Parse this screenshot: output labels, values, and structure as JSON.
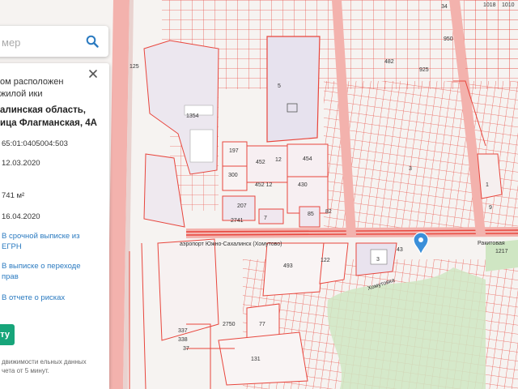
{
  "search": {
    "placeholder": "мер",
    "icon": "search-icon"
  },
  "panel": {
    "heading": "ом расположен жилой ики",
    "address_line1": "алинская область,",
    "address_line2": "ица Флагманская, 4А",
    "cadastral": "65:01:0405004:503",
    "date1": "12.03.2020",
    "area": "741 м²",
    "date2": "16.04.2020",
    "link_egrn": "В срочной выписке из ЕГРН",
    "link_transfer": "В выписке о переходе прав",
    "link_risks": "В отчете о рисках",
    "button_label": "сту",
    "footer": "движимости ельных данных чета от 5 минут."
  },
  "map": {
    "parcel_labels": [
      "125",
      "5",
      "1354",
      "197",
      "300",
      "452",
      "12",
      "454",
      "452 12",
      "430",
      "207",
      "2741",
      "7",
      "82",
      "85",
      "493",
      "122",
      "3",
      "43",
      "77",
      "2750",
      "131",
      "337",
      "338",
      "37",
      "34",
      "482",
      "9",
      "1018",
      "1010",
      "950",
      "925",
      "1217",
      "1",
      "3"
    ],
    "street_labels": [
      "Хомутовка",
      "аэропорт Южно-Сахалинск (Хомутово)",
      "Ракитовая"
    ],
    "marker_icon": "location-pin-icon",
    "colors": {
      "parcel_stroke": "#e8453c",
      "road_fill": "#f3b2ad",
      "green": "#cfe6c3",
      "background": "#f6f3f1",
      "accent": "#17a57a",
      "link": "#2a7ac0",
      "marker": "#3b8fd9"
    }
  }
}
